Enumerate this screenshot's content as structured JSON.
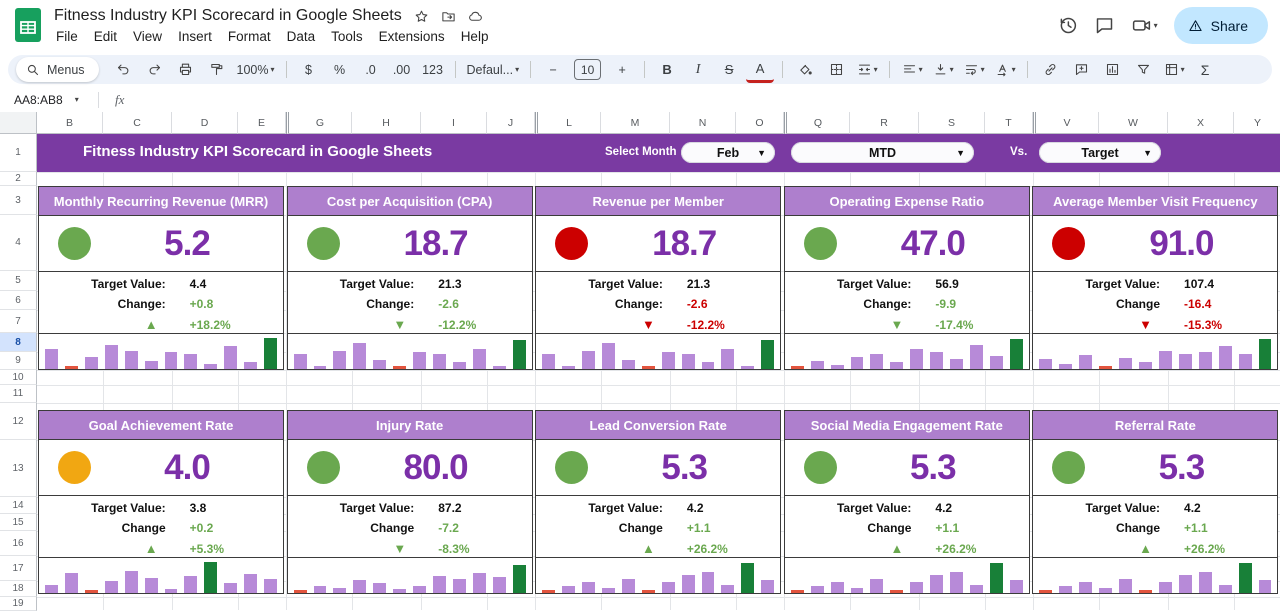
{
  "app": {
    "doc_title": "Fitness Industry KPI Scorecard in Google Sheets",
    "menus": [
      "File",
      "Edit",
      "View",
      "Insert",
      "Format",
      "Data",
      "Tools",
      "Extensions",
      "Help"
    ],
    "share_label": "Share"
  },
  "toolbar": {
    "menus_search": "Menus",
    "zoom": "100%",
    "currency": "$",
    "percent": "%",
    "decrease_decimal": ".0",
    "increase_decimal": ".00",
    "more_formats": "123",
    "font": "Defaul...",
    "decrease_font": "−",
    "font_size": "10",
    "increase_font": "+",
    "bold": "B",
    "italic": "I",
    "strikethrough": "S",
    "text_color": "A",
    "functions": "Σ"
  },
  "formula_bar": {
    "name_box": "AA8:AB8",
    "fx_label": "fx"
  },
  "grid": {
    "columns": [
      "B",
      "C",
      "D",
      "E",
      "G",
      "H",
      "I",
      "J",
      "L",
      "M",
      "N",
      "O",
      "Q",
      "R",
      "S",
      "T",
      "V",
      "W",
      "X",
      "Y"
    ],
    "rows": [
      1,
      2,
      3,
      4,
      5,
      6,
      7,
      8,
      9,
      10,
      11,
      12,
      13,
      14,
      15,
      16,
      17,
      18,
      19
    ],
    "selected_row": 8
  },
  "banner": {
    "title": "Fitness Industry KPI Scorecard in Google Sheets",
    "select_month_label": "Select Month",
    "month": "Feb",
    "period": "MTD",
    "vs_label": "Vs.",
    "compare": "Target"
  },
  "colors": {
    "banner_bg": "#7a3aa2",
    "card_header_bg": "#ae7fcd",
    "value_purple": "#7b2fa8",
    "green": "#6aa84f",
    "red": "#cc0000",
    "orange": "#f1a712",
    "spark_purple": "#b78ad8",
    "spark_green": "#188038",
    "spark_red": "#e2543e"
  },
  "cards": [
    {
      "title": "Monthly Recurring Revenue (MRR)",
      "status": "green",
      "value": "5.2",
      "target_label": "Target Value:",
      "target": "4.4",
      "change_label": "Change:",
      "change": "+0.8",
      "change_color": "green",
      "trend_arrow": "▲",
      "trend": "+18.2%",
      "spark": [
        [
          62,
          "p"
        ],
        [
          4,
          "r"
        ],
        [
          35,
          "p"
        ],
        [
          72,
          "p"
        ],
        [
          55,
          "p"
        ],
        [
          25,
          "p"
        ],
        [
          50,
          "p"
        ],
        [
          45,
          "p"
        ],
        [
          15,
          "p"
        ],
        [
          70,
          "p"
        ],
        [
          22,
          "p"
        ],
        [
          95,
          "g"
        ]
      ]
    },
    {
      "title": "Cost per Acquisition (CPA)",
      "status": "green",
      "value": "18.7",
      "target_label": "Target Value:",
      "target": "21.3",
      "change_label": "Change:",
      "change": "-2.6",
      "change_color": "green",
      "trend_arrow": "▼",
      "trend": "-12.2%",
      "spark": [
        [
          45,
          "p"
        ],
        [
          8,
          "p"
        ],
        [
          55,
          "p"
        ],
        [
          78,
          "p"
        ],
        [
          28,
          "p"
        ],
        [
          4,
          "r"
        ],
        [
          50,
          "p"
        ],
        [
          45,
          "p"
        ],
        [
          22,
          "p"
        ],
        [
          62,
          "p"
        ],
        [
          10,
          "p"
        ],
        [
          88,
          "g"
        ]
      ]
    },
    {
      "title": "Revenue per Member",
      "status": "red",
      "value": "18.7",
      "target_label": "Target Value:",
      "target": "21.3",
      "change_label": "Change:",
      "change": "-2.6",
      "change_color": "red",
      "trend_arrow": "▼",
      "trend": "-12.2%",
      "spark": [
        [
          45,
          "p"
        ],
        [
          8,
          "p"
        ],
        [
          55,
          "p"
        ],
        [
          78,
          "p"
        ],
        [
          28,
          "p"
        ],
        [
          4,
          "r"
        ],
        [
          50,
          "p"
        ],
        [
          45,
          "p"
        ],
        [
          22,
          "p"
        ],
        [
          62,
          "p"
        ],
        [
          10,
          "p"
        ],
        [
          88,
          "g"
        ]
      ]
    },
    {
      "title": "Operating Expense Ratio",
      "status": "green",
      "value": "47.0",
      "target_label": "Target Value:",
      "target": "56.9",
      "change_label": "Change:",
      "change": "-9.9",
      "change_color": "green",
      "trend_arrow": "▼",
      "trend": "-17.4%",
      "spark": [
        [
          4,
          "r"
        ],
        [
          25,
          "p"
        ],
        [
          12,
          "p"
        ],
        [
          35,
          "p"
        ],
        [
          45,
          "p"
        ],
        [
          20,
          "p"
        ],
        [
          60,
          "p"
        ],
        [
          50,
          "p"
        ],
        [
          30,
          "p"
        ],
        [
          72,
          "p"
        ],
        [
          40,
          "p"
        ],
        [
          90,
          "g"
        ]
      ]
    },
    {
      "title": "Average Member Visit Frequency",
      "status": "red",
      "value": "91.0",
      "target_label": "Target Value:",
      "target": "107.4",
      "change_label": "Change",
      "change": "-16.4",
      "change_color": "red",
      "trend_arrow": "▼",
      "trend": "-15.3%",
      "spark": [
        [
          30,
          "p"
        ],
        [
          15,
          "p"
        ],
        [
          42,
          "p"
        ],
        [
          4,
          "r"
        ],
        [
          32,
          "p"
        ],
        [
          22,
          "p"
        ],
        [
          55,
          "p"
        ],
        [
          45,
          "p"
        ],
        [
          50,
          "p"
        ],
        [
          70,
          "p"
        ],
        [
          45,
          "p"
        ],
        [
          90,
          "g"
        ]
      ]
    },
    {
      "title": "Goal Achievement Rate",
      "status": "orange",
      "value": "4.0",
      "target_label": "Target Value:",
      "target": "3.8",
      "change_label": "Change",
      "change": "+0.2",
      "change_color": "green",
      "trend_arrow": "▲",
      "trend": "+5.3%",
      "spark": [
        [
          25,
          "p"
        ],
        [
          60,
          "p"
        ],
        [
          4,
          "r"
        ],
        [
          35,
          "p"
        ],
        [
          68,
          "p"
        ],
        [
          45,
          "p"
        ],
        [
          12,
          "p"
        ],
        [
          50,
          "p"
        ],
        [
          95,
          "g"
        ],
        [
          30,
          "p"
        ],
        [
          58,
          "p"
        ],
        [
          42,
          "p"
        ]
      ]
    },
    {
      "title": "Injury Rate",
      "status": "green",
      "value": "80.0",
      "target_label": "Target Value:",
      "target": "87.2",
      "change_label": "Change",
      "change": "-7.2",
      "change_color": "green",
      "trend_arrow": "▼",
      "trend": "-8.3%",
      "spark": [
        [
          4,
          "r"
        ],
        [
          22,
          "p"
        ],
        [
          15,
          "p"
        ],
        [
          38,
          "p"
        ],
        [
          30,
          "p"
        ],
        [
          12,
          "p"
        ],
        [
          22,
          "p"
        ],
        [
          52,
          "p"
        ],
        [
          42,
          "p"
        ],
        [
          62,
          "p"
        ],
        [
          48,
          "p"
        ],
        [
          85,
          "g"
        ]
      ]
    },
    {
      "title": "Lead Conversion Rate",
      "status": "green",
      "value": "5.3",
      "target_label": "Target Value:",
      "target": "4.2",
      "change_label": "Change",
      "change": "+1.1",
      "change_color": "green",
      "trend_arrow": "▲",
      "trend": "+26.2%",
      "spark": [
        [
          4,
          "r"
        ],
        [
          22,
          "p"
        ],
        [
          32,
          "p"
        ],
        [
          15,
          "p"
        ],
        [
          42,
          "p"
        ],
        [
          4,
          "r"
        ],
        [
          32,
          "p"
        ],
        [
          55,
          "p"
        ],
        [
          65,
          "p"
        ],
        [
          25,
          "p"
        ],
        [
          90,
          "g"
        ],
        [
          38,
          "p"
        ]
      ]
    },
    {
      "title": "Social Media Engagement Rate",
      "status": "green",
      "value": "5.3",
      "target_label": "Target Value:",
      "target": "4.2",
      "change_label": "Change",
      "change": "+1.1",
      "change_color": "green",
      "trend_arrow": "▲",
      "trend": "+26.2%",
      "spark": [
        [
          4,
          "r"
        ],
        [
          22,
          "p"
        ],
        [
          32,
          "p"
        ],
        [
          15,
          "p"
        ],
        [
          42,
          "p"
        ],
        [
          4,
          "r"
        ],
        [
          32,
          "p"
        ],
        [
          55,
          "p"
        ],
        [
          65,
          "p"
        ],
        [
          25,
          "p"
        ],
        [
          90,
          "g"
        ],
        [
          38,
          "p"
        ]
      ]
    },
    {
      "title": "Referral Rate",
      "status": "green",
      "value": "5.3",
      "target_label": "Target Value:",
      "target": "4.2",
      "change_label": "Change",
      "change": "+1.1",
      "change_color": "green",
      "trend_arrow": "▲",
      "trend": "+26.2%",
      "spark": [
        [
          4,
          "r"
        ],
        [
          22,
          "p"
        ],
        [
          32,
          "p"
        ],
        [
          15,
          "p"
        ],
        [
          42,
          "p"
        ],
        [
          4,
          "r"
        ],
        [
          32,
          "p"
        ],
        [
          55,
          "p"
        ],
        [
          65,
          "p"
        ],
        [
          25,
          "p"
        ],
        [
          90,
          "g"
        ],
        [
          38,
          "p"
        ]
      ]
    }
  ]
}
